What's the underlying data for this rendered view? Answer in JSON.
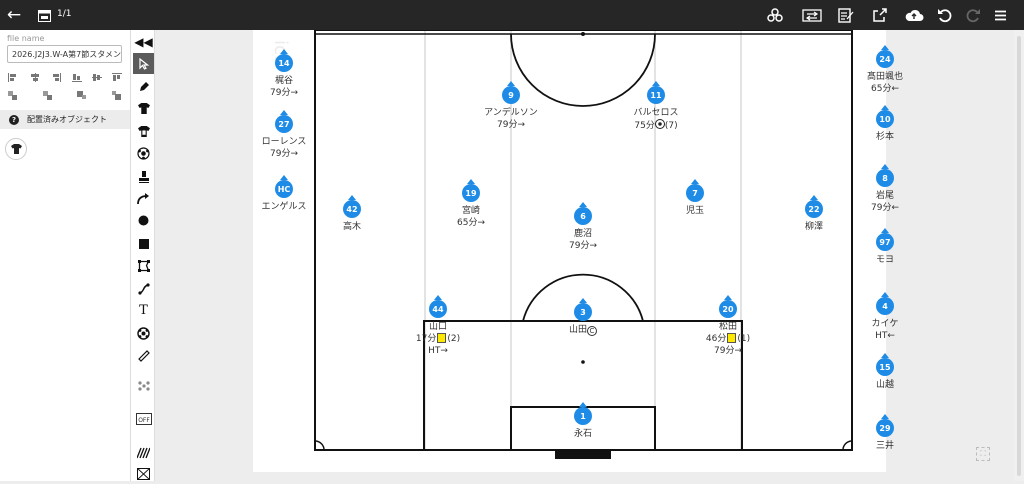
{
  "toolbar": {
    "back_icon": "arrow-left-icon",
    "page_count": "1/1",
    "icons": [
      "share-nodes-icon",
      "swap-players-icon",
      "notes-icon",
      "export-icon",
      "cloud-upload-icon",
      "undo-icon",
      "redo-icon",
      "menu-icon"
    ]
  },
  "left_panel": {
    "file_name_label": "file name",
    "file_name_value": "2026.J2J3.W-A第7節スタメン",
    "placed_objects_label": "配置済みオブジェクト"
  },
  "tools": [
    "collapse",
    "select",
    "pen",
    "shirt-dark",
    "shirt-light",
    "ball",
    "stamp",
    "curved-arrow",
    "circle",
    "square",
    "polygon",
    "line",
    "text",
    "ball-group",
    "ruler",
    "formation",
    "off",
    "grid",
    "pattern"
  ],
  "colors": {
    "player": "#1e8ce6",
    "yellow_card": "#ffe800",
    "topbar": "#262626"
  },
  "players": {
    "p1": {
      "number": "1",
      "name": "永石",
      "lines": []
    },
    "p3": {
      "number": "3",
      "name": "山田",
      "lines": []
    },
    "p44": {
      "number": "44",
      "name": "山口",
      "lines": [
        "17分",
        "HT→"
      ],
      "card": "(2)"
    },
    "p20": {
      "number": "20",
      "name": "松田",
      "lines": [
        "46分",
        "79分→"
      ],
      "card": "(1)"
    },
    "p6": {
      "number": "6",
      "name": "鹿沼",
      "lines": [
        "79分→"
      ]
    },
    "p19": {
      "number": "19",
      "name": "宮崎",
      "lines": [
        "65分→"
      ]
    },
    "p7": {
      "number": "7",
      "name": "児玉",
      "lines": []
    },
    "p42": {
      "number": "42",
      "name": "高木",
      "lines": []
    },
    "p22": {
      "number": "22",
      "name": "柳澤",
      "lines": []
    },
    "p9": {
      "number": "9",
      "name": "アンデルソン",
      "lines": [
        "79分→"
      ]
    },
    "p11": {
      "number": "11",
      "name": "バルセロス",
      "lines": [
        "75分",
        "(7)"
      ]
    }
  },
  "bench_left": [
    {
      "number": "14",
      "name": "梶谷",
      "line": "79分→"
    },
    {
      "number": "27",
      "name": "ローレンス",
      "line": "79分→"
    },
    {
      "number": "HC",
      "name": "エンゲルス",
      "line": ""
    }
  ],
  "bench_right": [
    {
      "number": "24",
      "name": "髙田颯也",
      "line": "65分←"
    },
    {
      "number": "10",
      "name": "杉本",
      "line": ""
    },
    {
      "number": "8",
      "name": "岩尾",
      "line": "79分←"
    },
    {
      "number": "97",
      "name": "モヨ",
      "line": ""
    },
    {
      "number": "4",
      "name": "カイケ",
      "line": "HT←"
    },
    {
      "number": "15",
      "name": "山越",
      "line": ""
    },
    {
      "number": "29",
      "name": "三井",
      "line": ""
    }
  ]
}
